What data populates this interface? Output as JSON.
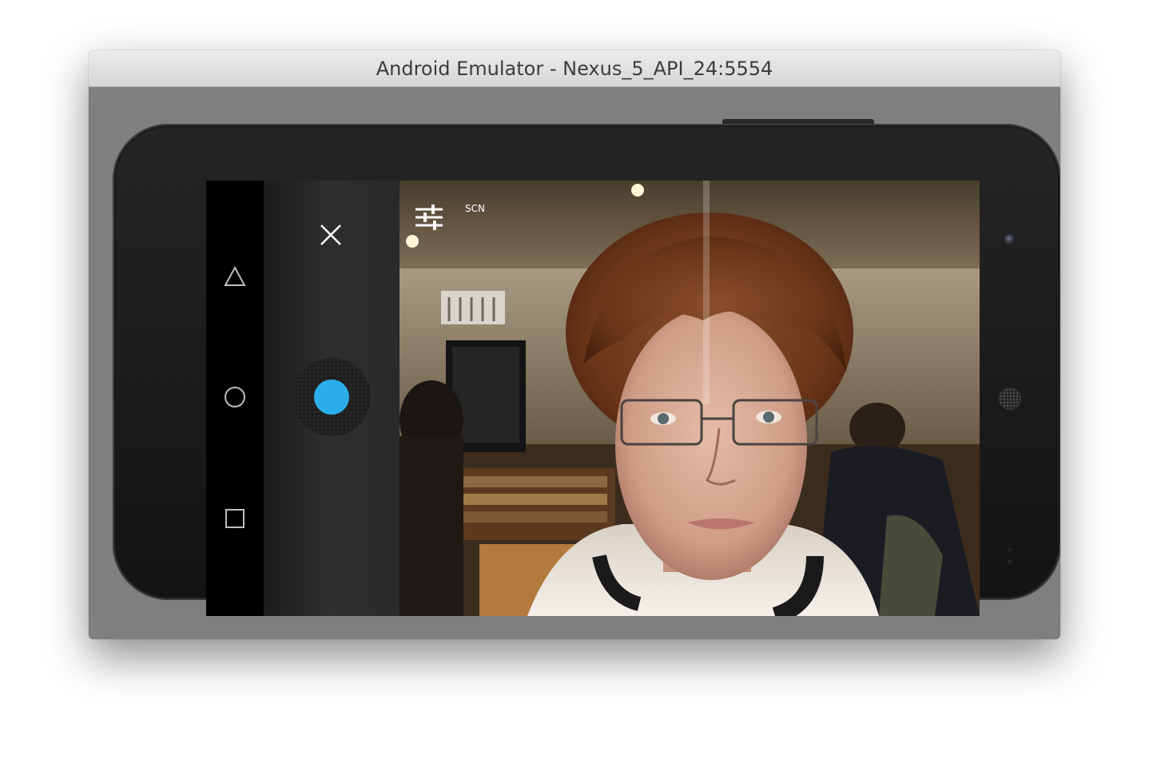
{
  "window": {
    "title": "Android Emulator - Nexus_5_API_24:5554"
  },
  "navbar": {
    "back_icon": "triangle-back-icon",
    "home_icon": "circle-home-icon",
    "recents_icon": "square-recents-icon"
  },
  "camera": {
    "close_icon": "close-icon",
    "shutter_color": "#2aaee9",
    "settings_icon": "sliders-icon",
    "scene_label": "SCN"
  },
  "colors": {
    "titlebar": "#e3e3e3",
    "emulator_frame": "#7f7f7f",
    "phone_body": "#1c1c1c",
    "accent": "#2aaee9"
  }
}
